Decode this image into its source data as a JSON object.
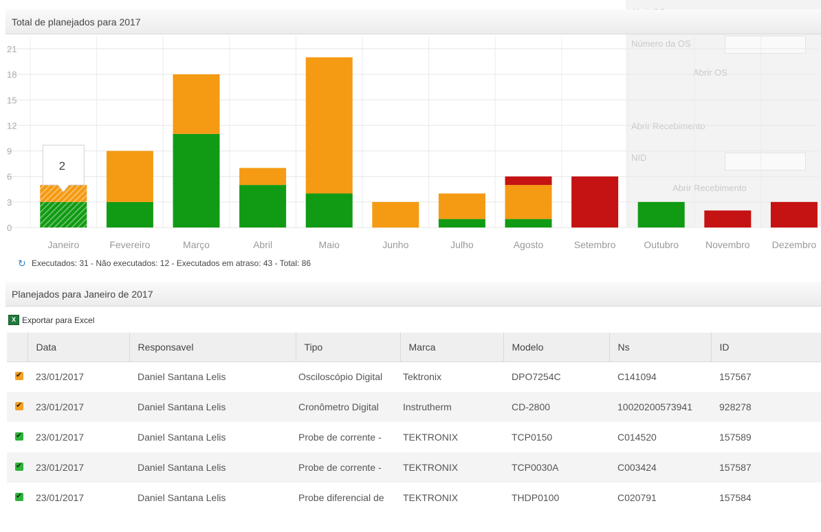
{
  "chart_panel": {
    "title": "Total de planejados para 2017"
  },
  "background_panel": {
    "abrir_os": "Abrir OS",
    "numero_os": "Número da OS",
    "abrir_os_button": "Abrir OS",
    "abrir_recebimento": "Abrir Recebimento",
    "nid": "NID",
    "abrir_recebimento_button": "Abrir Recebimento"
  },
  "tooltip": {
    "value": "2"
  },
  "chart_data": {
    "type": "bar",
    "stacked": true,
    "categories": [
      "Janeiro",
      "Fevereiro",
      "Março",
      "Abril",
      "Maio",
      "Junho",
      "Julho",
      "Agosto",
      "Setembro",
      "Outubro",
      "Novembro",
      "Dezembro"
    ],
    "series": [
      {
        "color": "#119b14",
        "values": [
          3,
          3,
          11,
          5,
          4,
          0,
          1,
          1,
          0,
          3,
          0,
          0
        ]
      },
      {
        "color": "#f59a13",
        "values": [
          2,
          6,
          7,
          2,
          16,
          3,
          3,
          4,
          0,
          0,
          0,
          0
        ]
      },
      {
        "color": "#c51212",
        "values": [
          0,
          0,
          0,
          0,
          0,
          0,
          0,
          1,
          6,
          0,
          2,
          3
        ]
      }
    ],
    "ylim": [
      0,
      21
    ],
    "yticks": [
      "0",
      "3",
      "6",
      "9",
      "12",
      "15",
      "18",
      "21"
    ],
    "grid": true,
    "highlighted_category": "Janeiro"
  },
  "summary": {
    "text": "Executados: 31 - Não executados: 12 - Executados em atraso: 43 - Total: 86"
  },
  "table_panel": {
    "title": "Planejados para Janeiro de 2017"
  },
  "export": {
    "label": "Exportar para Excel",
    "icon": "excel-icon"
  },
  "table": {
    "headers": [
      "Data",
      "Responsavel",
      "Tipo",
      "Marca",
      "Modelo",
      "Ns",
      "ID"
    ],
    "rows": [
      {
        "status": "orange",
        "cells": [
          "23/01/2017",
          "Daniel Santana Lelis",
          "Osciloscópio Digital",
          "Tektronix",
          "DPO7254C",
          "C141094",
          "157567"
        ]
      },
      {
        "status": "orange",
        "cells": [
          "23/01/2017",
          "Daniel Santana Lelis",
          "Cronômetro Digital",
          "Instrutherm",
          "CD-2800",
          "10020200573941",
          "928278"
        ]
      },
      {
        "status": "green",
        "cells": [
          "23/01/2017",
          "Daniel Santana Lelis",
          "Probe de corrente -",
          "TEKTRONIX",
          "TCP0150",
          "C014520",
          "157589"
        ]
      },
      {
        "status": "green",
        "cells": [
          "23/01/2017",
          "Daniel Santana Lelis",
          "Probe de corrente -",
          "TEKTRONIX",
          "TCP0030A",
          "C003424",
          "157587"
        ]
      },
      {
        "status": "green",
        "cells": [
          "23/01/2017",
          "Daniel Santana Lelis",
          "Probe diferencial de",
          "TEKTRONIX",
          "THDP0100",
          "C020791",
          "157584"
        ]
      }
    ]
  }
}
